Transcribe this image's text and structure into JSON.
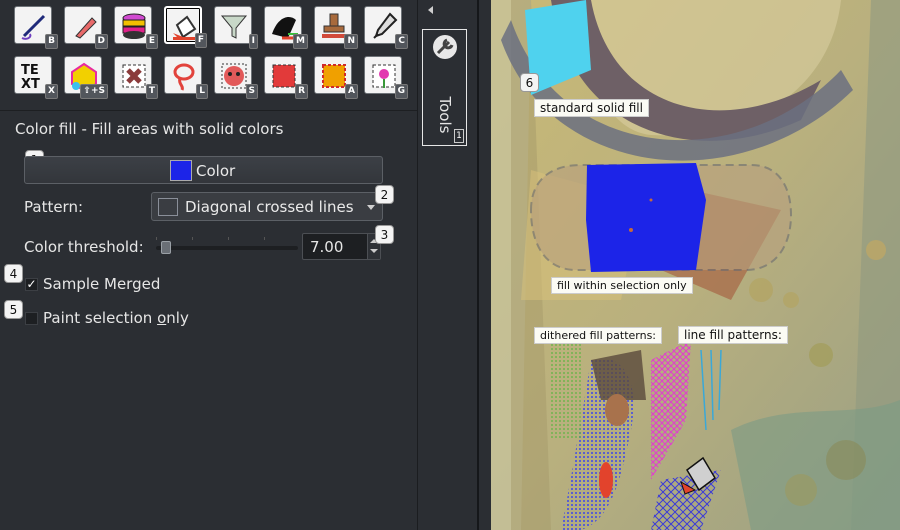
{
  "tools": [
    {
      "key": "B",
      "icon": "brush-icon"
    },
    {
      "key": "D",
      "icon": "pencil-icon"
    },
    {
      "key": "E",
      "icon": "eraser-icon"
    },
    {
      "key": "F",
      "icon": "fill-bucket-icon",
      "active": true
    },
    {
      "key": "I",
      "icon": "funnel-icon"
    },
    {
      "key": "M",
      "icon": "magic-fill-icon"
    },
    {
      "key": "N",
      "icon": "stamp-icon"
    },
    {
      "key": "C",
      "icon": "eyedropper-icon"
    },
    {
      "key": "X",
      "icon": "text-icon"
    },
    {
      "key": "⇧+S",
      "icon": "shapes-icon"
    },
    {
      "key": "T",
      "icon": "transform-icon"
    },
    {
      "key": "L",
      "icon": "lasso-icon"
    },
    {
      "key": "S",
      "icon": "select-icon"
    },
    {
      "key": "R",
      "icon": "rect-select-icon"
    },
    {
      "key": "A",
      "icon": "auto-select-icon"
    },
    {
      "key": "G",
      "icon": "flower-icon"
    }
  ],
  "panel": {
    "title": "Color fill - Fill areas with solid colors",
    "color_button": {
      "label": "Color",
      "swatch": "#1c24e8",
      "badge": "1"
    },
    "pattern": {
      "label": "Pattern:",
      "value": "Diagonal crossed lines",
      "badge": "2"
    },
    "threshold": {
      "label": "Color threshold:",
      "value": "7.00",
      "badge": "3"
    },
    "sample_merged": {
      "label": "Sample Merged",
      "checked": true,
      "badge": "4"
    },
    "paint_selection": {
      "label_pre": "Paint selection ",
      "label_u": "o",
      "label_post": "nly",
      "checked": false,
      "badge": "5"
    }
  },
  "dock": {
    "tab_label": "Tools",
    "tab_number": "1"
  },
  "canvas": {
    "badge": "6",
    "notes": {
      "solid": "standard solid fill",
      "selection": "fill within selection only",
      "dithered": "dithered fill patterns:",
      "line": "line fill patterns:"
    }
  },
  "colors": {
    "panel_bg": "#2b2e33",
    "fill_blue": "#1c24e8",
    "accent_white": "#f4f4f4"
  }
}
